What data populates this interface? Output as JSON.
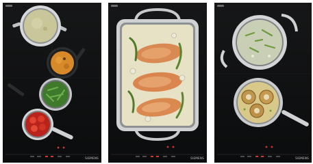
{
  "panels": [
    {
      "id": "cooktop-four-pans",
      "brand": "SIEMENS"
    },
    {
      "id": "cooktop-roasting-pan",
      "brand": "SIEMENS"
    },
    {
      "id": "cooktop-two-pans",
      "brand": "SIEMENS"
    }
  ],
  "colors": {
    "cooktop": "#101112",
    "control_red": "#d23a30",
    "steel": "#c9cbcd"
  }
}
